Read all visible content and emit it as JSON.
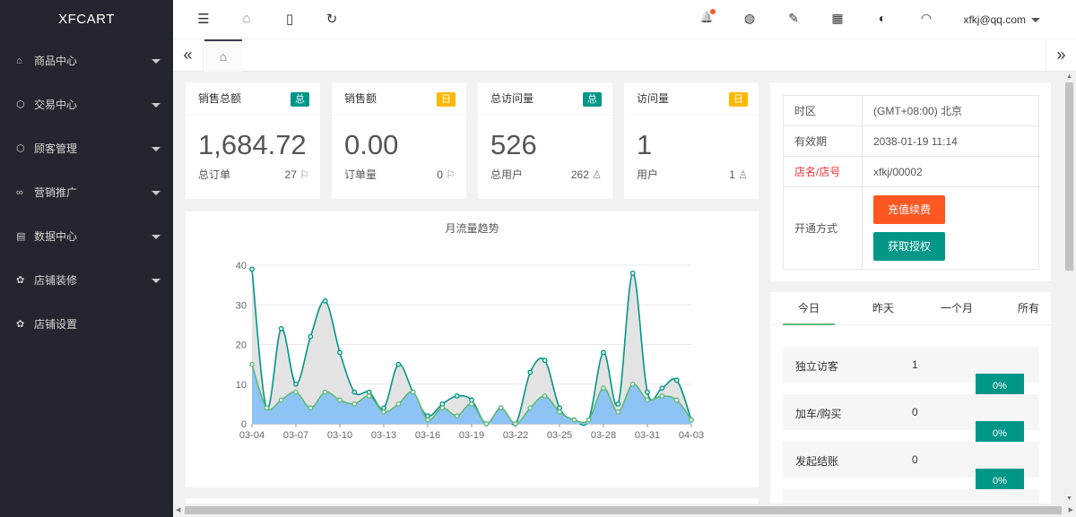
{
  "app": {
    "logo": "XFCART"
  },
  "sidebar": {
    "items": [
      {
        "label": "商品中心",
        "icon": "⌂",
        "has_submenu": true
      },
      {
        "label": "交易中心",
        "icon": "⬡",
        "has_submenu": true
      },
      {
        "label": "顾客管理",
        "icon": "⬡",
        "has_submenu": true
      },
      {
        "label": "营销推广",
        "icon": "∞",
        "has_submenu": true
      },
      {
        "label": "数据中心",
        "icon": "▤",
        "has_submenu": true
      },
      {
        "label": "店铺装修",
        "icon": "✿",
        "has_submenu": true
      },
      {
        "label": "店铺设置",
        "icon": "✿",
        "has_submenu": false
      }
    ]
  },
  "topbar": {
    "icons": {
      "collapse": "☰",
      "home": "⌂",
      "mobile": "▯",
      "refresh": "↻",
      "bell": "🔔",
      "globe": "◍",
      "clean": "✎",
      "calendar": "▦",
      "theme": "◐",
      "support": "◠"
    },
    "user": "xfkj@qq.com"
  },
  "tabsbar": {
    "prev": "«",
    "home": "⌂",
    "next": "»"
  },
  "stats": [
    {
      "title": "销售总额",
      "badge": "总",
      "badge_type": "total",
      "value": "1,684.72",
      "foot_label": "总订单",
      "foot_num": "27",
      "foot_icon": "⚐"
    },
    {
      "title": "销售额",
      "badge": "日",
      "badge_type": "day",
      "value": "0.00",
      "foot_label": "订单量",
      "foot_num": "0",
      "foot_icon": "⚐"
    },
    {
      "title": "总访问量",
      "badge": "总",
      "badge_type": "total",
      "value": "526",
      "foot_label": "总用户",
      "foot_num": "262",
      "foot_icon": "♙"
    },
    {
      "title": "访问量",
      "badge": "日",
      "badge_type": "day",
      "value": "1",
      "foot_label": "用户",
      "foot_num": "1",
      "foot_icon": "♙"
    }
  ],
  "info": {
    "rows": [
      {
        "label": "时区",
        "value": "(GMT+08:00) 北京"
      },
      {
        "label": "有效期",
        "value": "2038-01-19 11:14"
      },
      {
        "label": "店名/店号",
        "value": "xfkj/00002",
        "highlight": true
      }
    ],
    "open_label": "开通方式",
    "renew_button": "充值续费",
    "license_button": "获取授权",
    "colors": {
      "orange": "#ff5722",
      "green": "#009688"
    }
  },
  "visits": {
    "tabs": [
      "今日",
      "昨天",
      "一个月",
      "所有"
    ],
    "active_tab": 0,
    "rows": [
      {
        "label": "独立访客",
        "value": "1"
      },
      {
        "label": "加车/购买",
        "value": "0"
      },
      {
        "label": "发起结账",
        "value": "0"
      }
    ],
    "percents": [
      "0%",
      "0%",
      "0%"
    ]
  },
  "chart_data": {
    "type": "area",
    "title": "月流量趋势",
    "xlabel": "",
    "ylabel": "",
    "ylim": [
      0,
      40
    ],
    "yticks": [
      0,
      10,
      20,
      30,
      40
    ],
    "x": [
      "03-04",
      "03-05",
      "03-06",
      "03-07",
      "03-08",
      "03-09",
      "03-10",
      "03-11",
      "03-12",
      "03-13",
      "03-14",
      "03-15",
      "03-16",
      "03-17",
      "03-18",
      "03-19",
      "03-20",
      "03-21",
      "03-22",
      "03-23",
      "03-24",
      "03-25",
      "03-26",
      "03-27",
      "03-28",
      "03-29",
      "03-30",
      "03-31",
      "04-01",
      "04-02",
      "04-03"
    ],
    "xtick_labels": [
      "03-04",
      "03-07",
      "03-10",
      "03-13",
      "03-16",
      "03-19",
      "03-22",
      "03-25",
      "03-28",
      "03-31",
      "04-03"
    ],
    "series": [
      {
        "values": [
          39,
          4,
          24,
          10,
          22,
          31,
          18,
          8,
          8,
          4,
          15,
          8,
          2,
          5,
          7,
          6,
          0,
          4,
          0,
          13,
          16,
          4,
          1,
          1,
          18,
          5,
          38,
          8,
          9,
          11,
          1
        ],
        "color": "#009688",
        "fill": "#e3e3e3"
      },
      {
        "values": [
          15,
          4,
          6,
          8,
          4,
          8,
          6,
          5,
          7,
          3,
          5,
          8,
          1,
          4,
          2,
          5,
          0,
          4,
          0,
          4,
          7,
          3,
          1,
          1,
          9,
          3,
          10,
          6,
          7,
          6,
          1
        ],
        "color": "#5fb878",
        "fill": "#8ec4f5"
      }
    ],
    "grid": true
  }
}
